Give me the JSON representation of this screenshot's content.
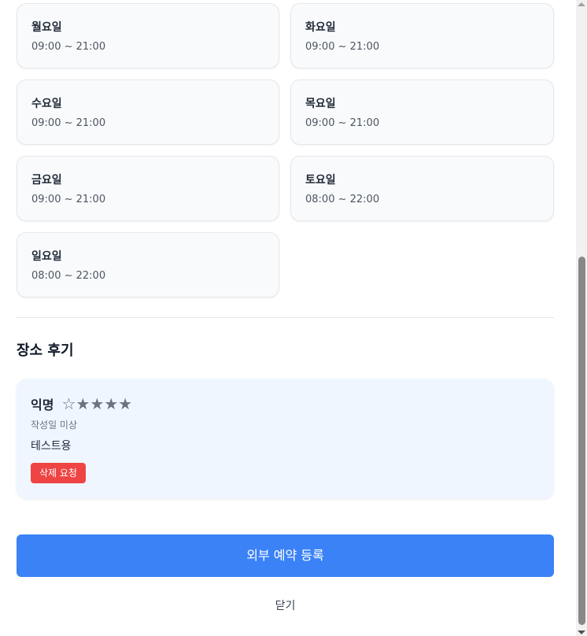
{
  "opening_hours": [
    {
      "day": "월요일",
      "hours": "09:00 ~ 21:00"
    },
    {
      "day": "화요일",
      "hours": "09:00 ~ 21:00"
    },
    {
      "day": "수요일",
      "hours": "09:00 ~ 21:00"
    },
    {
      "day": "목요일",
      "hours": "09:00 ~ 21:00"
    },
    {
      "day": "금요일",
      "hours": "09:00 ~ 21:00"
    },
    {
      "day": "토요일",
      "hours": "08:00 ~ 22:00"
    },
    {
      "day": "일요일",
      "hours": "08:00 ~ 22:00"
    }
  ],
  "reviews": {
    "title": "장소 후기",
    "items": [
      {
        "author": "익명",
        "stars": "☆★★★★",
        "date": "작성일 미상",
        "body": "테스트용",
        "delete_label": "삭제 요청"
      }
    ]
  },
  "actions": {
    "register_label": "외부 예약 등록",
    "close_label": "닫기"
  },
  "colors": {
    "primary": "#3b82f6",
    "danger": "#ef4444",
    "review_bg": "#eff6ff"
  }
}
